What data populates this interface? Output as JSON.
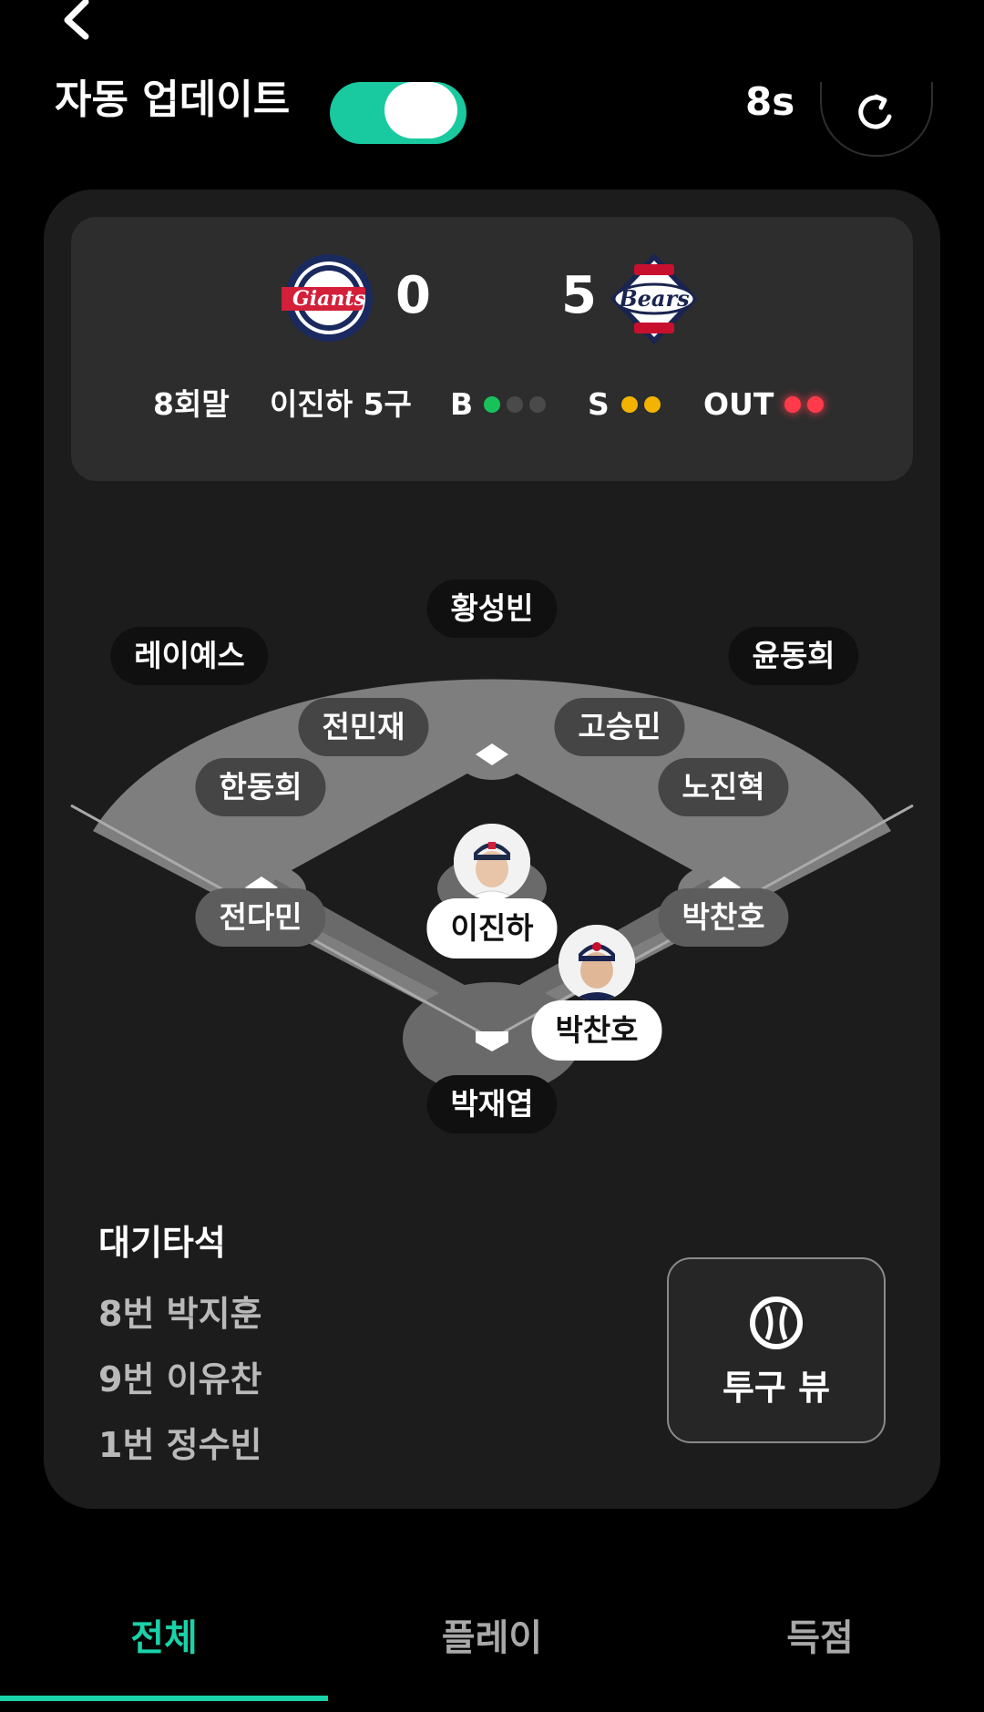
{
  "header": {
    "auto_update_label": "자동 업데이트",
    "auto_update_on": true,
    "timer": "8s",
    "accent": "#19c9a0"
  },
  "scoreboard": {
    "away": {
      "logo_icon": "giants-logo",
      "score": "0"
    },
    "home": {
      "logo_icon": "bears-logo",
      "score": "5"
    },
    "inning": "8회말",
    "pitch": "이진하 5구",
    "balls_label": "B",
    "balls": 1,
    "strikes_label": "S",
    "strikes": 2,
    "outs_label": "OUT",
    "outs": 2,
    "colors": {
      "ball": "#17c25a",
      "strike": "#f2b400",
      "out": "#ff3b4b",
      "empty": "#4a4a4a"
    }
  },
  "field": {
    "center_fielder": "황성빈",
    "left_fielder": "레이예스",
    "right_fielder": "윤동희",
    "shortstop": "전민재",
    "second_baseman": "고승민",
    "third_baseman": "한동희",
    "first_baseman": "노진혁",
    "third_base_runner": "전다민",
    "first_base_runner": "박찬호",
    "pitcher": "이진하",
    "batter": "박찬호",
    "catcher": "박재엽"
  },
  "on_deck": {
    "title": "대기타석",
    "items": [
      "8번 박지훈",
      "9번 이유찬",
      "1번 정수빈"
    ]
  },
  "pitch_view_label": "투구 뷰",
  "tabs": [
    {
      "label": "전체",
      "active": true
    },
    {
      "label": "플레이",
      "active": false
    },
    {
      "label": "득점",
      "active": false
    }
  ]
}
